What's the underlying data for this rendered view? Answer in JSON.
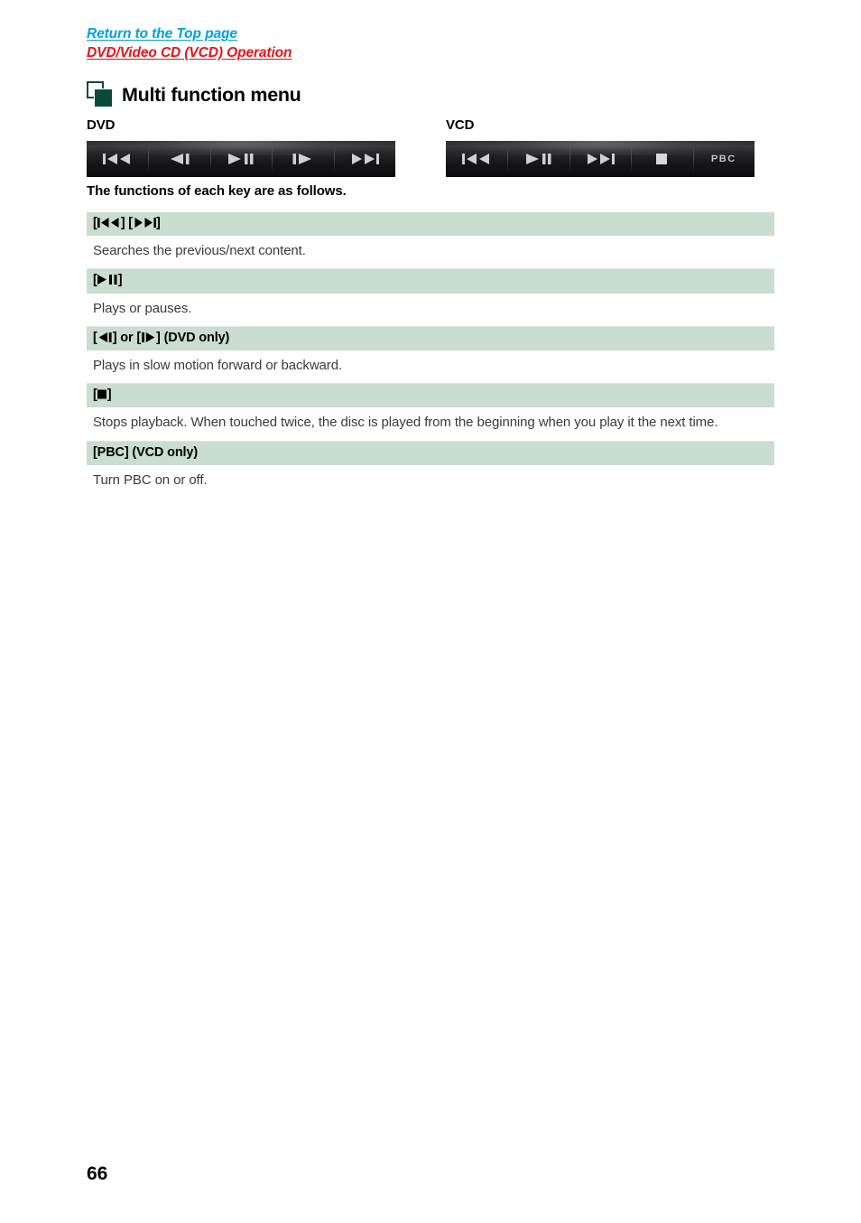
{
  "breadcrumb": {
    "top_link": "Return to the Top page",
    "section_link": "DVD/Video CD (VCD) Operation",
    "top_link_color": "#00a0e1",
    "section_link_color": "#e8121a"
  },
  "section": {
    "icon": "two-squares-icon",
    "title": "Multi function menu",
    "icon_color": "#0b4a38"
  },
  "bars": {
    "dvd": {
      "caption": "DVD",
      "keys": [
        {
          "name": "previous-track-key",
          "glyph": "|<<",
          "label": "Search previous"
        },
        {
          "name": "slow-backward-key",
          "glyph": "<|",
          "label": "Slow motion backward"
        },
        {
          "name": "play-pause-key",
          "glyph": ">||",
          "label": "Play or pause"
        },
        {
          "name": "slow-forward-key",
          "glyph": "|>",
          "label": "Slow motion forward"
        },
        {
          "name": "next-track-key",
          "glyph": ">>|",
          "label": "Search next"
        }
      ]
    },
    "vcd": {
      "caption": "VCD",
      "keys": [
        {
          "name": "previous-track-key",
          "glyph": "|<<",
          "label": "Search previous"
        },
        {
          "name": "play-pause-key",
          "glyph": ">||",
          "label": "Play or pause"
        },
        {
          "name": "next-track-key",
          "glyph": ">>|",
          "label": "Search next"
        },
        {
          "name": "stop-key",
          "glyph": "[]",
          "label": "Stop"
        },
        {
          "name": "pbc-key",
          "glyph": "PBC",
          "label": "PBC"
        }
      ]
    }
  },
  "intro": "The functions of each key are as follows.",
  "table": {
    "rows": [
      {
        "header_prefix": "[",
        "header_suffix": "]",
        "header_text": "[|◀◀] [▶▶|]",
        "header_icons": "prev-next",
        "body": "Searches the previous/next content."
      },
      {
        "header_text": "[▶II]",
        "header_icons": "play-pause",
        "body": "Plays or pauses."
      },
      {
        "header_text": "[◀I] or [I▶] (DVD only)",
        "header_icons": "slow-both",
        "header_tail": " (DVD only)",
        "body": "Plays in slow motion forward or backward."
      },
      {
        "header_text": "[■]",
        "header_icons": "stop",
        "body": "Stops playback. When touched twice, the disc is played from the beginning when you play it the next time."
      },
      {
        "header_text": "[PBC] (VCD only)",
        "header_icons": "none",
        "body": "Turn PBC on or off."
      }
    ],
    "header_bg": "#c9ddd1"
  },
  "page_number": "66"
}
